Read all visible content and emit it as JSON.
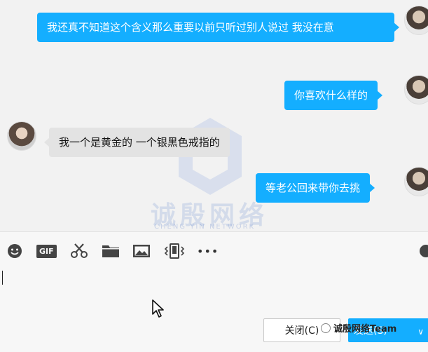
{
  "messages": [
    {
      "side": "right",
      "text": "我还真不知道这个含义那么重要以前只听过别人说过 我没在意"
    },
    {
      "side": "right",
      "text": "你喜欢什么样的"
    },
    {
      "side": "left",
      "text": "我一个是黄金的  一个银黑色戒指的"
    },
    {
      "side": "right",
      "text": "等老公回来带你去挑"
    }
  ],
  "watermark": {
    "title": "诚殷网络",
    "subtitle": "CHENG YIN NETWORK"
  },
  "toolbar": {
    "gif_label": "GIF",
    "more_label": "•••"
  },
  "buttons": {
    "close_label": "关闭(C)",
    "send_label": "发送(S)",
    "send_arrow": "∨"
  },
  "overlay_badge": {
    "text": "诚殷网络Team"
  },
  "colors": {
    "accent": "#14aeff",
    "bubble_other": "#e3e3e3"
  }
}
